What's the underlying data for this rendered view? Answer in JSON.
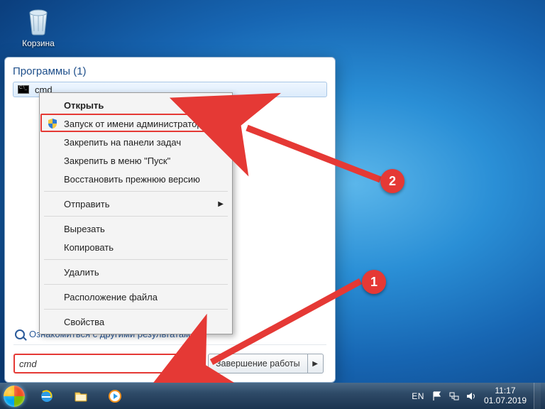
{
  "desktop": {
    "recycle_bin_label": "Корзина"
  },
  "start_panel": {
    "header": "Программы (1)",
    "result_label": "cmd",
    "see_more": "Ознакомиться с другими результатами",
    "search_value": "cmd",
    "shutdown_label": "Завершение работы"
  },
  "context_menu": {
    "items": [
      {
        "label": "Открыть",
        "bold": true
      },
      {
        "label": "Запуск от имени администратора",
        "shield": true,
        "highlight": true
      },
      {
        "label": "Закрепить на панели задач"
      },
      {
        "label": "Закрепить в меню \"Пуск\""
      },
      {
        "label": "Восстановить прежнюю версию"
      }
    ],
    "items2": [
      {
        "label": "Отправить",
        "submenu": true
      }
    ],
    "items3": [
      {
        "label": "Вырезать"
      },
      {
        "label": "Копировать"
      }
    ],
    "items4": [
      {
        "label": "Удалить"
      }
    ],
    "items5": [
      {
        "label": "Расположение файла"
      }
    ],
    "items6": [
      {
        "label": "Свойства"
      }
    ]
  },
  "annotations": {
    "marker1": "1",
    "marker2": "2"
  },
  "taskbar": {
    "lang": "EN",
    "time": "11:17",
    "date": "01.07.2019"
  }
}
